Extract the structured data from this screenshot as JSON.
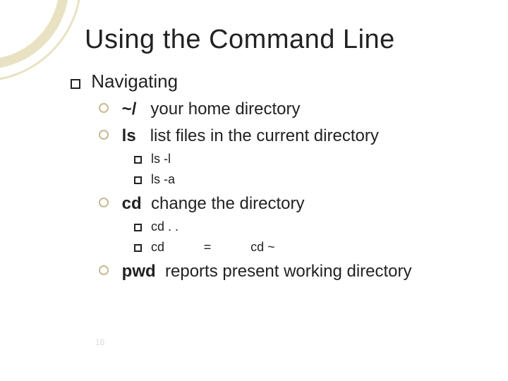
{
  "title": "Using the Command Line",
  "section_heading": "Navigating",
  "items": {
    "home": {
      "cmd": "~/",
      "desc": "your home directory"
    },
    "ls": {
      "cmd": "ls",
      "desc": "list files in the current directory",
      "opts": [
        "ls -l",
        "ls -a"
      ]
    },
    "cd": {
      "cmd": "cd",
      "desc": "change the directory",
      "opts_a": "cd . .",
      "opts_b_left": "cd",
      "opts_b_eq": "=",
      "opts_b_right": "cd ~"
    },
    "pwd": {
      "cmd": "pwd",
      "desc": "reports present working directory"
    }
  },
  "page_number": "16"
}
